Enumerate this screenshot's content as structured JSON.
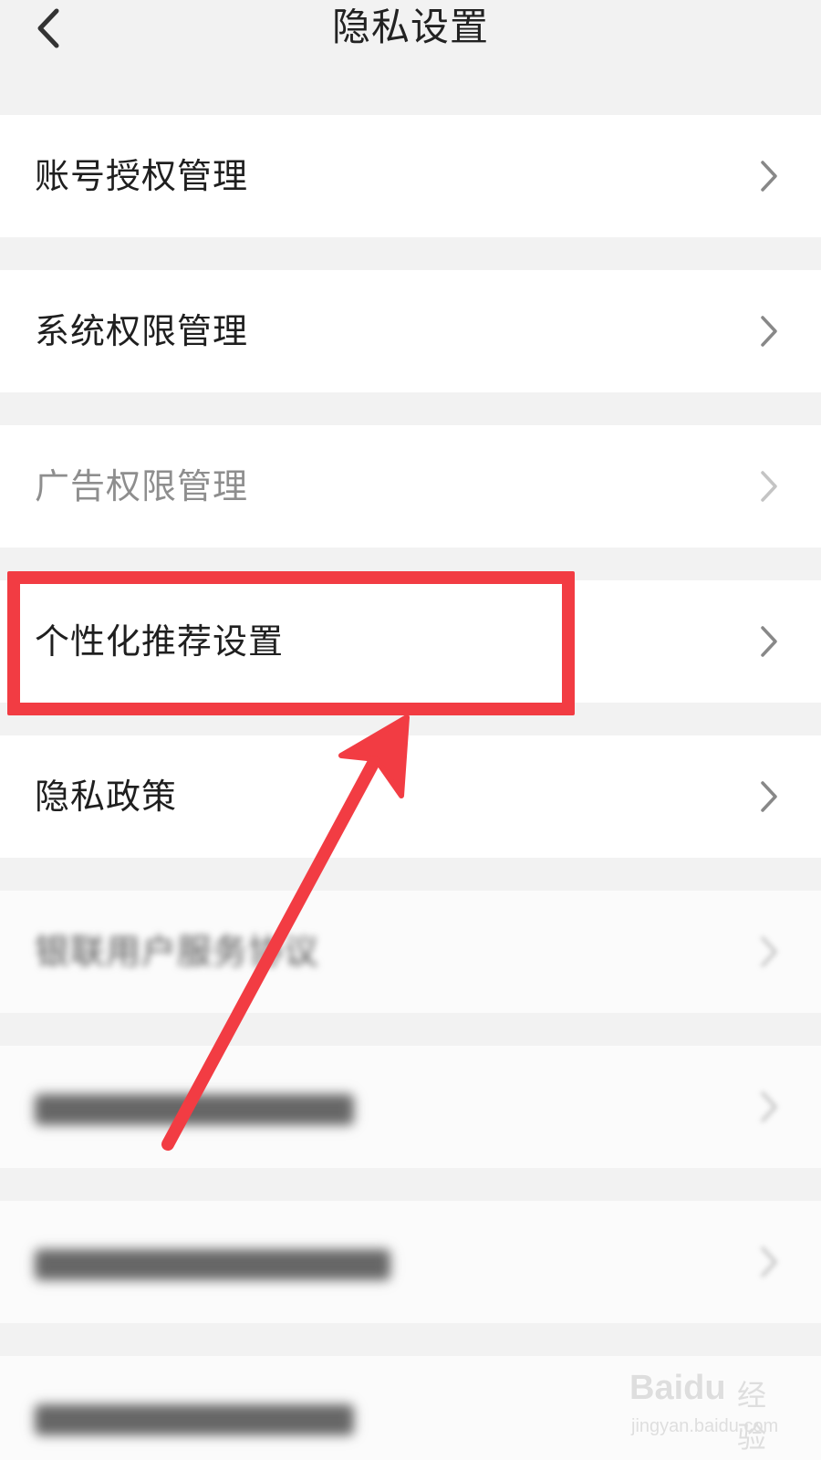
{
  "header": {
    "title": "隐私设置",
    "back_icon": "chevron-left-icon"
  },
  "rows": [
    {
      "label": "账号授权管理"
    },
    {
      "label": "系统权限管理"
    },
    {
      "label": "广告权限管理"
    },
    {
      "label": "个性化推荐设置"
    },
    {
      "label": "隐私政策"
    },
    {
      "label": "银联用户服务协议"
    }
  ],
  "annotation": {
    "highlight_color": "#f23c43",
    "arrow_color": "#f23c43"
  },
  "watermark": {
    "logo": "Baidu",
    "text": "经验",
    "url": "jingyan.baidu.com"
  }
}
